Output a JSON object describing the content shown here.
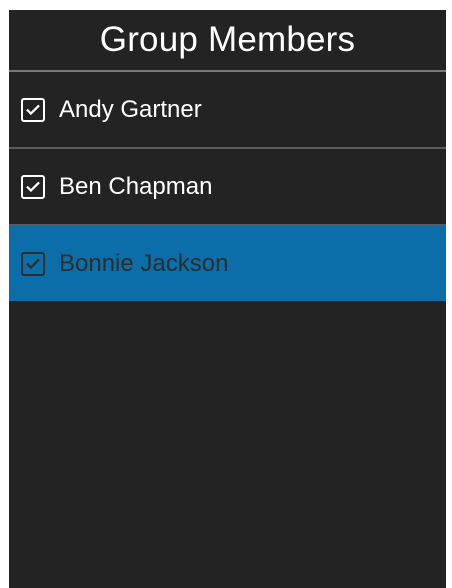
{
  "header": {
    "title": "Group Members"
  },
  "members": [
    {
      "name": "Andy Gartner",
      "checked": true,
      "selected": false
    },
    {
      "name": "Ben Chapman",
      "checked": true,
      "selected": false
    },
    {
      "name": "Bonnie Jackson",
      "checked": true,
      "selected": true
    }
  ],
  "colors": {
    "background": "#232323",
    "selected_row": "#0b6ea9",
    "text": "#ffffff",
    "selected_text": "#2d2d2d"
  },
  "icons": {
    "checkbox": "check-icon"
  }
}
